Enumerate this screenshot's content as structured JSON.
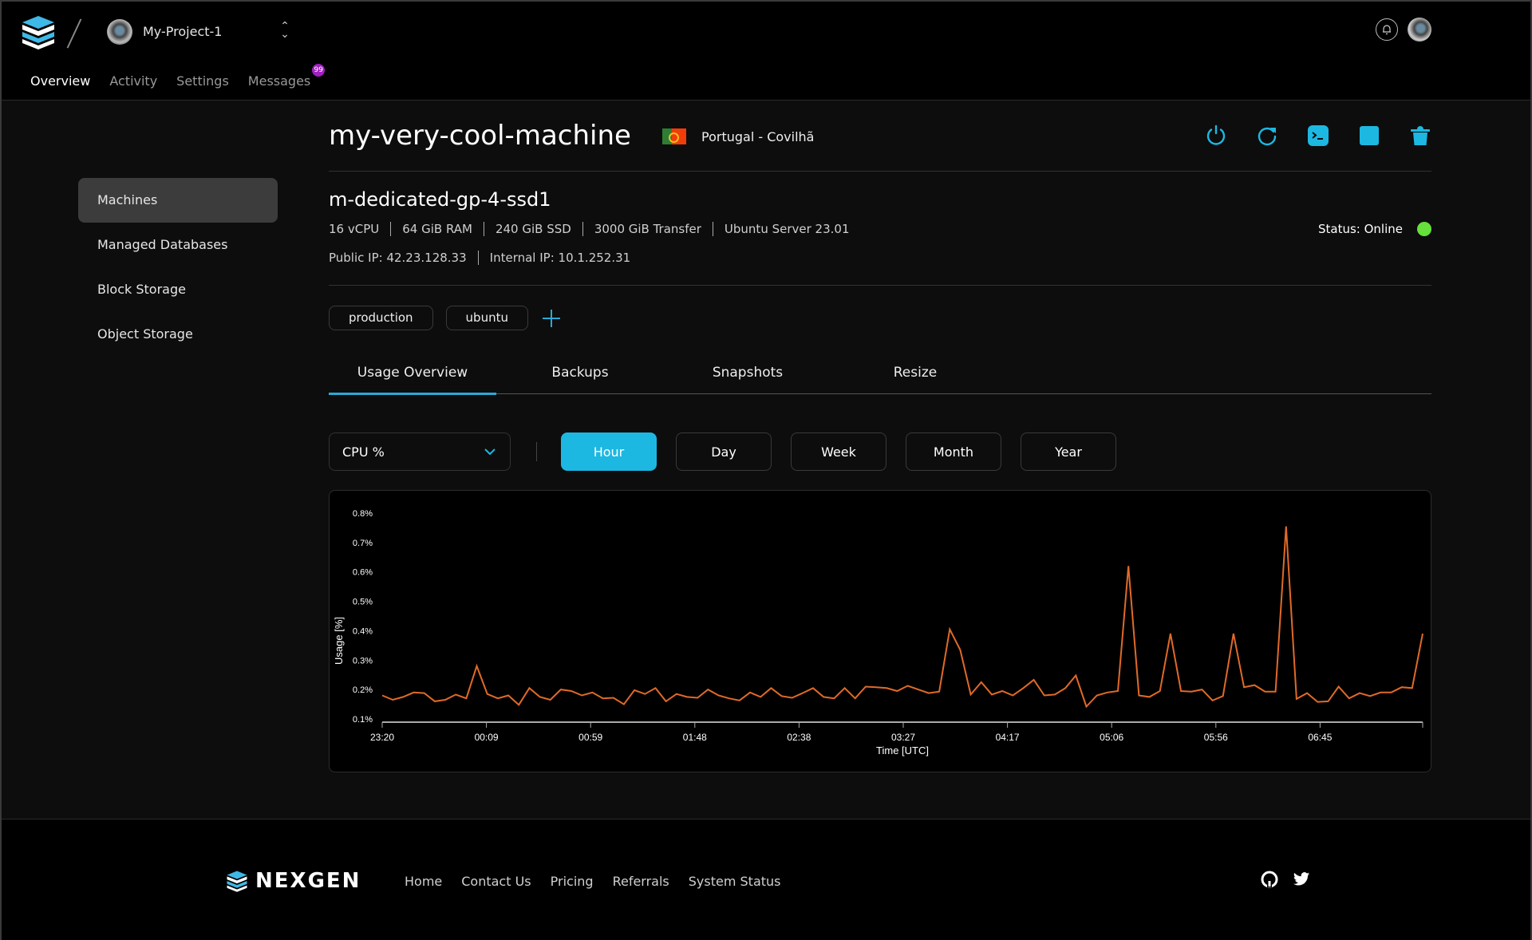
{
  "header": {
    "project_name": "My-Project-1",
    "nav": [
      {
        "label": "Overview",
        "active": true
      },
      {
        "label": "Activity",
        "active": false
      },
      {
        "label": "Settings",
        "active": false
      },
      {
        "label": "Messages",
        "active": false,
        "badge": "99"
      }
    ]
  },
  "sidebar": {
    "items": [
      {
        "label": "Machines",
        "active": true
      },
      {
        "label": "Managed Databases",
        "active": false
      },
      {
        "label": "Block Storage",
        "active": false
      },
      {
        "label": "Object Storage",
        "active": false
      }
    ]
  },
  "machine": {
    "name": "my-very-cool-machine",
    "location": "Portugal - Covilhã",
    "flag": "portugal-flag",
    "plan": "m-dedicated-gp-4-ssd1",
    "specs": [
      "16 vCPU",
      "64 GiB RAM",
      "240 GiB SSD",
      "3000 GiB Transfer",
      "Ubuntu Server 23.01"
    ],
    "public_ip": "Public IP: 42.23.128.33",
    "internal_ip": "Internal IP: 10.1.252.31",
    "status": "Status: Online",
    "status_color": "#66e03a",
    "tags": [
      "production",
      "ubuntu"
    ],
    "actions": [
      "power-icon",
      "restart-icon",
      "console-icon",
      "stop-icon",
      "delete-icon"
    ]
  },
  "tabs": [
    {
      "label": "Usage Overview",
      "active": true
    },
    {
      "label": "Backups",
      "active": false
    },
    {
      "label": "Snapshots",
      "active": false
    },
    {
      "label": "Resize",
      "active": false
    }
  ],
  "controls": {
    "metric": "CPU %",
    "ranges": [
      {
        "label": "Hour",
        "active": true
      },
      {
        "label": "Day",
        "active": false
      },
      {
        "label": "Week",
        "active": false
      },
      {
        "label": "Month",
        "active": false
      },
      {
        "label": "Year",
        "active": false
      }
    ]
  },
  "accent_color": "#1cb8e2",
  "chart_data": {
    "type": "line",
    "title": "",
    "xlabel": "Time [UTC]",
    "ylabel": "Usage [%]",
    "ylim": [
      0.1,
      0.8
    ],
    "yticks": [
      "0.1%",
      "0.2%",
      "0.3%",
      "0.4%",
      "0.5%",
      "0.6%",
      "0.7%",
      "0.8%"
    ],
    "xticks": [
      "23:20",
      "00:09",
      "00:59",
      "01:48",
      "02:38",
      "03:27",
      "04:17",
      "05:06",
      "05:56",
      "06:45"
    ],
    "grid": false,
    "line_color": "#e06a28",
    "series": [
      {
        "name": "CPU %",
        "values": [
          0.18,
          0.165,
          0.175,
          0.19,
          0.188,
          0.16,
          0.165,
          0.183,
          0.17,
          0.28,
          0.185,
          0.17,
          0.18,
          0.148,
          0.205,
          0.175,
          0.165,
          0.2,
          0.195,
          0.18,
          0.19,
          0.17,
          0.172,
          0.15,
          0.198,
          0.185,
          0.205,
          0.16,
          0.185,
          0.175,
          0.172,
          0.2,
          0.18,
          0.17,
          0.163,
          0.19,
          0.175,
          0.205,
          0.178,
          0.172,
          0.188,
          0.205,
          0.175,
          0.17,
          0.205,
          0.17,
          0.21,
          0.208,
          0.205,
          0.195,
          0.213,
          0.2,
          0.188,
          0.193,
          0.405,
          0.335,
          0.183,
          0.225,
          0.183,
          0.195,
          0.18,
          0.205,
          0.233,
          0.18,
          0.183,
          0.205,
          0.248,
          0.142,
          0.18,
          0.19,
          0.195,
          0.62,
          0.18,
          0.175,
          0.195,
          0.39,
          0.195,
          0.193,
          0.2,
          0.163,
          0.178,
          0.39,
          0.208,
          0.215,
          0.193,
          0.193,
          0.755,
          0.168,
          0.188,
          0.158,
          0.16,
          0.21,
          0.17,
          0.188,
          0.178,
          0.19,
          0.19,
          0.208,
          0.205,
          0.39
        ]
      }
    ]
  },
  "footer": {
    "brand": "NEXGEN",
    "links": [
      "Home",
      "Contact Us",
      "Pricing",
      "Referrals",
      "System Status"
    ],
    "social": [
      "github-icon",
      "twitter-icon"
    ]
  }
}
